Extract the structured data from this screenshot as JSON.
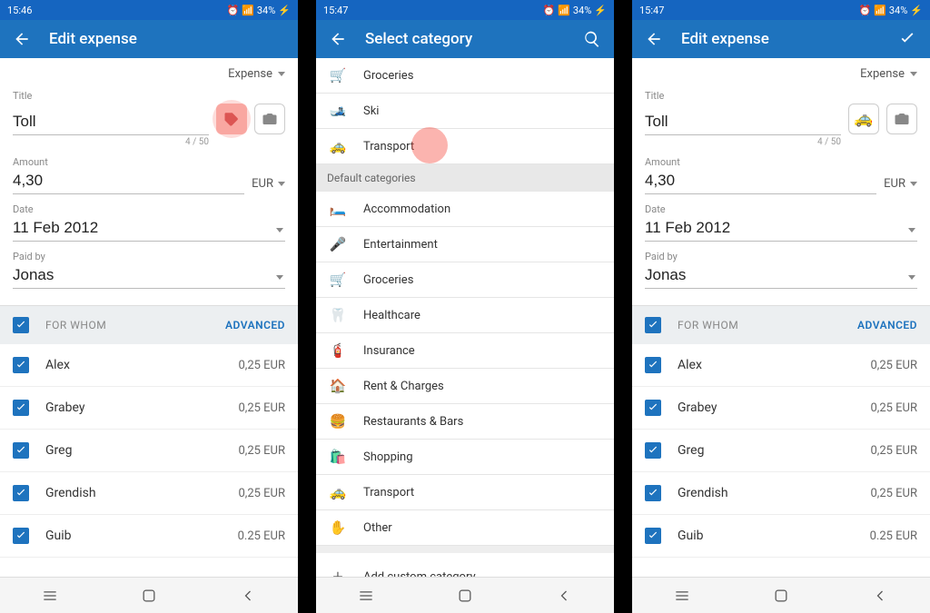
{
  "status": {
    "time1": "15:46",
    "time2": "15:47",
    "time3": "15:47",
    "battery": "34%"
  },
  "screen1": {
    "title": "Edit expense",
    "type": "Expense",
    "fields": {
      "title_label": "Title",
      "title_value": "Toll",
      "char_count": "4 / 50",
      "amount_label": "Amount",
      "amount_value": "4,30",
      "currency": "EUR",
      "date_label": "Date",
      "date_value": "11 Feb 2012",
      "paidby_label": "Paid by",
      "paidby_value": "Jonas"
    },
    "whom": {
      "header": "FOR WHOM",
      "advanced": "ADVANCED",
      "people": [
        {
          "name": "Alex",
          "amt": "0,25 EUR"
        },
        {
          "name": "Grabey",
          "amt": "0,25 EUR"
        },
        {
          "name": "Greg",
          "amt": "0,25 EUR"
        },
        {
          "name": "Grendish",
          "amt": "0,25 EUR"
        },
        {
          "name": "Guib",
          "amt": "0.25 EUR"
        }
      ]
    }
  },
  "screen2": {
    "title": "Select category",
    "recent": [
      {
        "icon": "🛒",
        "label": "Groceries"
      },
      {
        "icon": "🎿",
        "label": "Ski"
      },
      {
        "icon": "🚕",
        "label": "Transport"
      }
    ],
    "section": "Default categories",
    "defaults": [
      {
        "icon": "🛏️",
        "label": "Accommodation"
      },
      {
        "icon": "🎤",
        "label": "Entertainment"
      },
      {
        "icon": "🛒",
        "label": "Groceries"
      },
      {
        "icon": "🦷",
        "label": "Healthcare"
      },
      {
        "icon": "🧯",
        "label": "Insurance"
      },
      {
        "icon": "🏠",
        "label": "Rent & Charges"
      },
      {
        "icon": "🍔",
        "label": "Restaurants & Bars"
      },
      {
        "icon": "🛍️",
        "label": "Shopping"
      },
      {
        "icon": "🚕",
        "label": "Transport"
      },
      {
        "icon": "✋",
        "label": "Other"
      }
    ],
    "add_custom": "Add custom category"
  },
  "screen3": {
    "title": "Edit expense",
    "type": "Expense",
    "fields": {
      "title_label": "Title",
      "title_value": "Toll",
      "char_count": "4 / 50",
      "amount_label": "Amount",
      "amount_value": "4,30",
      "currency": "EUR",
      "date_label": "Date",
      "date_value": "11 Feb 2012",
      "paidby_label": "Paid by",
      "paidby_value": "Jonas"
    },
    "whom": {
      "header": "FOR WHOM",
      "advanced": "ADVANCED",
      "people": [
        {
          "name": "Alex",
          "amt": "0,25 EUR"
        },
        {
          "name": "Grabey",
          "amt": "0,25 EUR"
        },
        {
          "name": "Greg",
          "amt": "0,25 EUR"
        },
        {
          "name": "Grendish",
          "amt": "0,25 EUR"
        },
        {
          "name": "Guib",
          "amt": "0.25 EUR"
        }
      ]
    }
  }
}
